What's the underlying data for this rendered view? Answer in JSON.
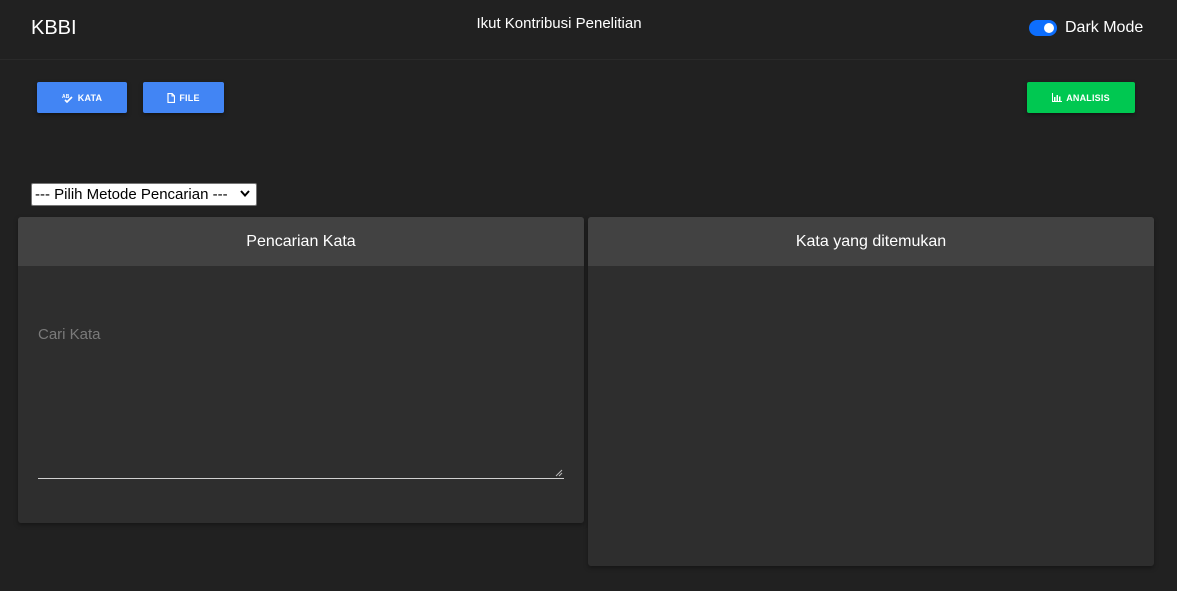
{
  "navbar": {
    "brand": "KBBI",
    "center_link": "Ikut Kontribusi Penelitian",
    "dark_mode_label": "Dark Mode",
    "dark_mode_on": true
  },
  "toolbar": {
    "kata_label": "KATA",
    "file_label": "FILE",
    "analisis_label": "ANALISIS"
  },
  "search_method": {
    "selected": "--- Pilih Metode Pencarian ---"
  },
  "search_card": {
    "title": "Pencarian Kata",
    "placeholder": "Cari Kata"
  },
  "result_card": {
    "title": "Kata yang ditemukan"
  },
  "colors": {
    "background": "#212121",
    "card": "#2e2e2e",
    "card_header": "#424242",
    "primary_blue": "#4285f4",
    "success_green": "#00c851",
    "toggle_blue": "#0d6efd"
  },
  "icons": {
    "kata": "spell-check-icon",
    "file": "file-icon",
    "analisis": "bar-chart-icon"
  }
}
